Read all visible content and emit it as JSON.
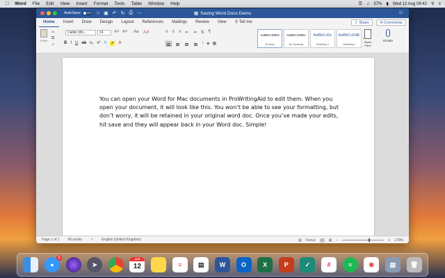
{
  "menubar": {
    "app_name": "Word",
    "items": [
      "File",
      "Edit",
      "View",
      "Insert",
      "Format",
      "Tools",
      "Table",
      "Window",
      "Help"
    ],
    "battery": "57%",
    "datetime": "Wed 12 Aug  09:42"
  },
  "titlebar": {
    "autosave_label": "AutoSave",
    "autosave_state": "OFF",
    "doc_title": "Saving Word Docs Demo"
  },
  "ribbon_tabs": [
    "Home",
    "Insert",
    "Draw",
    "Design",
    "Layout",
    "References",
    "Mailings",
    "Review",
    "View"
  ],
  "tell_me": "Tell me",
  "share_label": "Share",
  "comments_label": "Comments",
  "ribbon": {
    "paste_label": "Paste",
    "font_name": "Calibri (Bo...",
    "font_size": "14",
    "styles": [
      {
        "sample": "AaBbCcDdEe",
        "label": "Normal"
      },
      {
        "sample": "AaBbCcDdEe",
        "label": "No Spacing"
      },
      {
        "sample": "AaBbCcDc",
        "label": "Heading 1"
      },
      {
        "sample": "AaBbCcDdE",
        "label": "Heading 2"
      }
    ],
    "styles_pane_label": "Styles Pane",
    "dictate_label": "Dictate"
  },
  "document": {
    "body": "You can open your Word for Mac documents in ProWritingAid to edit them. When you open your document, it will look like this. You won’t be able to see your formatting, but don’t worry, it will be retained in your original word doc. Once you’ve made your edits, hit save and they will appear back in your Word doc. Simple!"
  },
  "statusbar": {
    "page": "Page 1 of 1",
    "words": "60 words",
    "language": "English (United Kingdom)",
    "focus": "Focus",
    "zoom": "170%"
  },
  "dock": {
    "messages_badge": "3",
    "calendar_month": "AUG",
    "calendar_day": "12"
  }
}
